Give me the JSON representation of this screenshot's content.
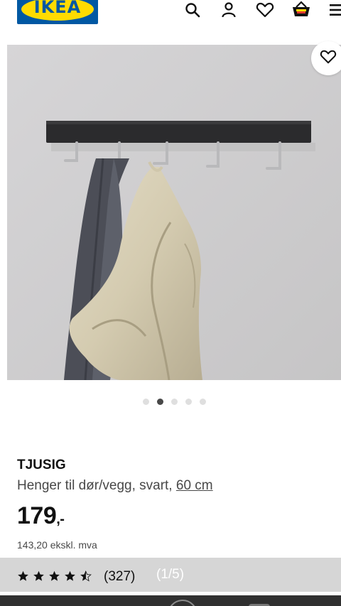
{
  "brand": {
    "logo_text": "IKEA",
    "logo_blue": "#0058a3",
    "logo_yellow": "#ffdb00"
  },
  "header": {
    "icons": [
      "search-icon",
      "account-icon",
      "heart-icon",
      "shopping-bag-icon",
      "menu-icon"
    ]
  },
  "product": {
    "image_alt_icon": "coat-rack-photo",
    "favorite_icon": "heart-icon",
    "name": "TJUSIG",
    "description": "Henger til dør/vegg, svart, ",
    "size_link": "60 cm",
    "price_main": "179",
    "price_suffix": ",-",
    "price_ex_vat": "143,20 ekskl. mva"
  },
  "carousel": {
    "total": 5,
    "active_index": 1
  },
  "rating": {
    "stars": 4.5,
    "review_count": "(327)",
    "image_counter": "(1/5)"
  },
  "colors": {
    "accent": "#111111",
    "muted": "#484848",
    "rating_bar": "#d6d6d6"
  }
}
